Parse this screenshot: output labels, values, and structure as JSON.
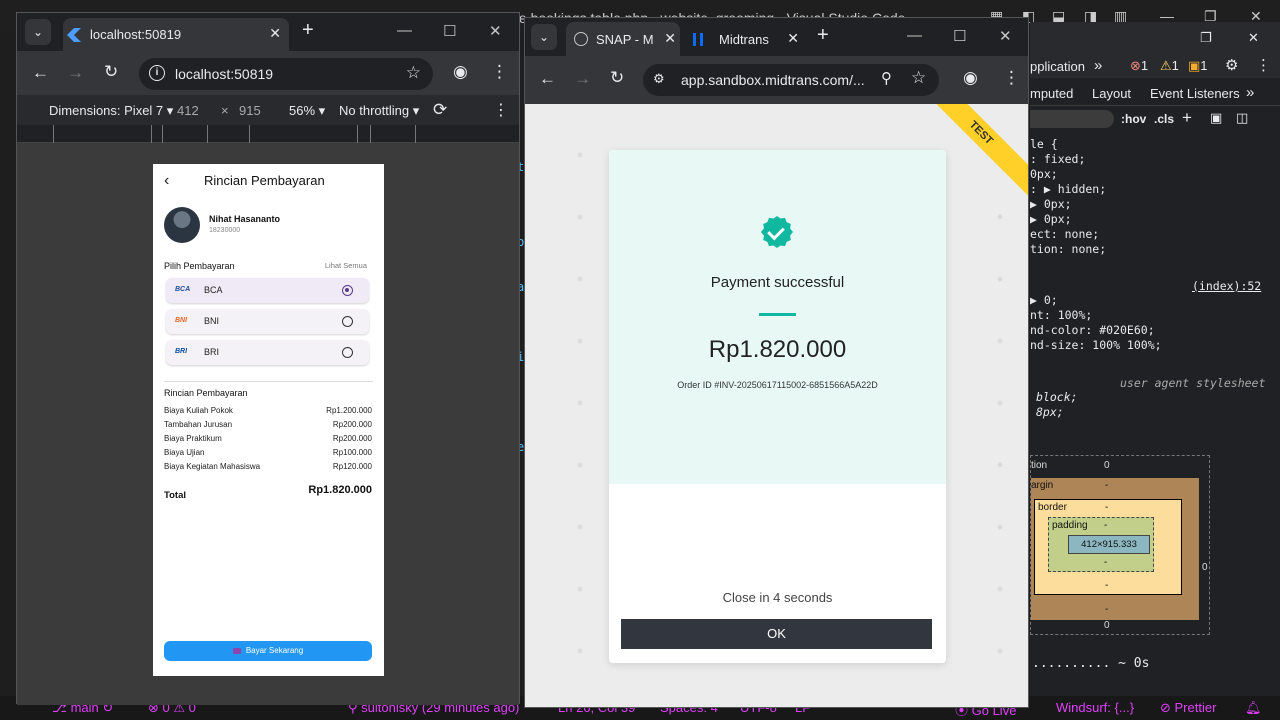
{
  "vscode": {
    "title": "te bookings table.php - website_grooming - Visual Studio Code",
    "status": {
      "branch": "main",
      "errors": "0",
      "warnings": "0",
      "author": "sultonisky (29 minutes ago)",
      "position": "Ln 26, Col 39",
      "spaces": "Spaces: 4",
      "encoding": "UTF-8",
      "eol": "LF",
      "golive": "Go Live",
      "windsurf": "Windsurf: {...}",
      "prettier": "Prettier"
    }
  },
  "left_browser": {
    "tab_title": "localhost:50819",
    "url": "localhost:50819",
    "device": {
      "dimensions_label": "Dimensions: Pixel 7",
      "width": "412",
      "times": "×",
      "height": "915",
      "zoom": "56%",
      "throttling": "No throttling"
    },
    "app": {
      "page_title": "Rincian Pembayaran",
      "user": {
        "name": "Nihat Hasananto",
        "id": "18230000"
      },
      "select_section": "Pilih Pembayaran",
      "see_all": "Lihat Semua",
      "banks": [
        {
          "logo": "BCA",
          "name": "BCA",
          "selected": true,
          "color": "#1a4ea1"
        },
        {
          "logo": "BNI",
          "name": "BNI",
          "selected": false,
          "color": "#f26522"
        },
        {
          "logo": "BRI",
          "name": "BRI",
          "selected": false,
          "color": "#0a4ea3"
        }
      ],
      "details_title": "Rincian Pembayaran",
      "items": [
        {
          "label": "Biaya Kuliah Pokok",
          "amount": "Rp1.200.000"
        },
        {
          "label": "Tambahan Jurusan",
          "amount": "Rp200.000"
        },
        {
          "label": "Biaya Praktikum",
          "amount": "Rp200.000"
        },
        {
          "label": "Biaya Ujian",
          "amount": "Rp100.000"
        },
        {
          "label": "Biaya Kegiatan Mahasiswa",
          "amount": "Rp120.000"
        }
      ],
      "total_label": "Total",
      "total_value": "Rp1.820.000",
      "pay_button": "Bayar Sekarang"
    }
  },
  "mid_browser": {
    "tabs": [
      {
        "label": "SNAP - M"
      },
      {
        "label": "Midtrans"
      }
    ],
    "url": "app.sandbox.midtrans.com/...",
    "ribbon": "TEST",
    "snap": {
      "message": "Payment successful",
      "amount": "Rp1.820.000",
      "order_id": "Order ID #INV-20250617115002-6851566A5A22D",
      "countdown": "Close in 4 seconds",
      "ok_button": "OK"
    }
  },
  "devtools": {
    "tabs": [
      "pplication",
      "»",
      "1",
      "1",
      "1"
    ],
    "subtabs": [
      "mputed",
      "Layout",
      "Event Listeners",
      "»"
    ],
    "filter_buttons": [
      ":hov",
      ".cls",
      "+"
    ],
    "code_lines": [
      "le {",
      ": fixed;",
      " 0px;",
      ": ▶ hidden;",
      " ▶ 0px;",
      " ▶ 0px;",
      "ect: none;",
      "tion: none;"
    ],
    "source_link": "(index):52",
    "code_lines2": [
      "▶ 0;",
      "nt: 100%;",
      "nd-color:  #020E60;",
      "nd-size: 100% 100%;"
    ],
    "ua_label": "user agent stylesheet",
    "ua_lines": [
      "block;",
      "8px;"
    ],
    "box": {
      "position_label": "tion",
      "position_value": "0",
      "margin_label": "argin",
      "margin_value": "-",
      "border_label": "border",
      "border_value": "-",
      "padding_label": "padding",
      "padding_value": "-",
      "content": "412×915.333",
      "side_value": "-",
      "bottom_value": "0",
      "right_value": "0"
    },
    "timeline": ".......... ~ 0s"
  }
}
